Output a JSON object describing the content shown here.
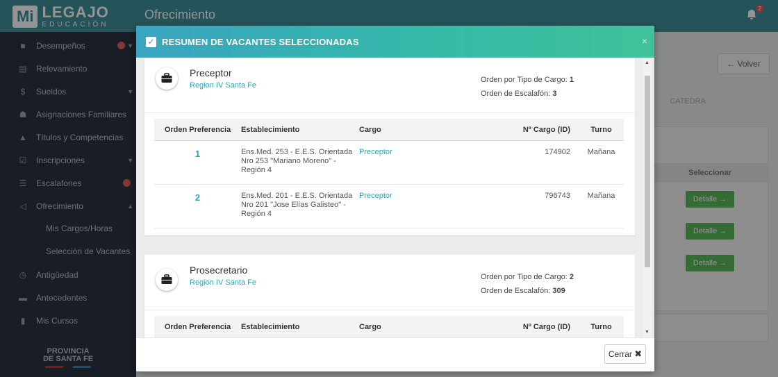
{
  "app": {
    "logo_mi": "Mi",
    "logo_legajo": "LEGAJO",
    "logo_edu": "EDUCACIÓN",
    "page_title": "Ofrecimiento",
    "notifications": "2"
  },
  "sidebar": {
    "items": [
      {
        "label": "Desempeños",
        "icon": "briefcase-icon"
      },
      {
        "label": "Relevamiento",
        "icon": "clipboard-icon"
      },
      {
        "label": "Sueldos",
        "icon": "dollar-icon"
      },
      {
        "label": "Asignaciones Familiares",
        "icon": "family-icon"
      },
      {
        "label": "Títulos y Competencias",
        "icon": "graduation-cap-icon"
      },
      {
        "label": "Inscripciones",
        "icon": "check-square-icon"
      },
      {
        "label": "Escalafones",
        "icon": "list-icon"
      },
      {
        "label": "Ofrecimiento",
        "icon": "megaphone-icon"
      }
    ],
    "sub_items": [
      "Mis Cargos/Horas",
      "Selección de Vacantes"
    ],
    "items_after": [
      {
        "label": "Antigüedad",
        "icon": "history-icon"
      },
      {
        "label": "Antecedentes",
        "icon": "folder-icon"
      },
      {
        "label": "Mis Cursos",
        "icon": "book-icon"
      }
    ],
    "footer_line1": "PROVINCIA",
    "footer_line2": "DE SANTA FE"
  },
  "background": {
    "volver": "← Volver",
    "tab_catedra": "CATEDRA",
    "seleccionar": "Seleccionar",
    "detalle": "Detalle →"
  },
  "modal": {
    "title": "RESUMEN DE VACANTES SELECCIONADAS",
    "close": "×",
    "cerrar": "Cerrar",
    "meta_tipo_label": "Orden por Tipo de Cargo:",
    "meta_escalafon_label": "Orden de Escalafón:",
    "columns": [
      "Orden Preferencia",
      "Establecimiento",
      "Cargo",
      "Nº Cargo (ID)",
      "Turno"
    ],
    "cards": [
      {
        "cargo": "Preceptor",
        "region": "Region IV Santa Fe",
        "orden_tipo": "1",
        "orden_escalafon": "3",
        "rows": [
          {
            "orden": "1",
            "establecimiento": "Ens.Med. 253 - E.E.S. Orientada Nro 253 \"Mariano Moreno\" - Región 4",
            "cargo": "Preceptor",
            "id": "174902",
            "turno": "Mañana"
          },
          {
            "orden": "2",
            "establecimiento": "Ens.Med. 201 - E.E.S. Orientada Nro 201 \"Jose Elías Galisteo\" - Región 4",
            "cargo": "Preceptor",
            "id": "796743",
            "turno": "Mañana"
          }
        ]
      },
      {
        "cargo": "Prosecretario",
        "region": "Region IV Santa Fe",
        "orden_tipo": "2",
        "orden_escalafon": "309",
        "rows": []
      }
    ]
  }
}
